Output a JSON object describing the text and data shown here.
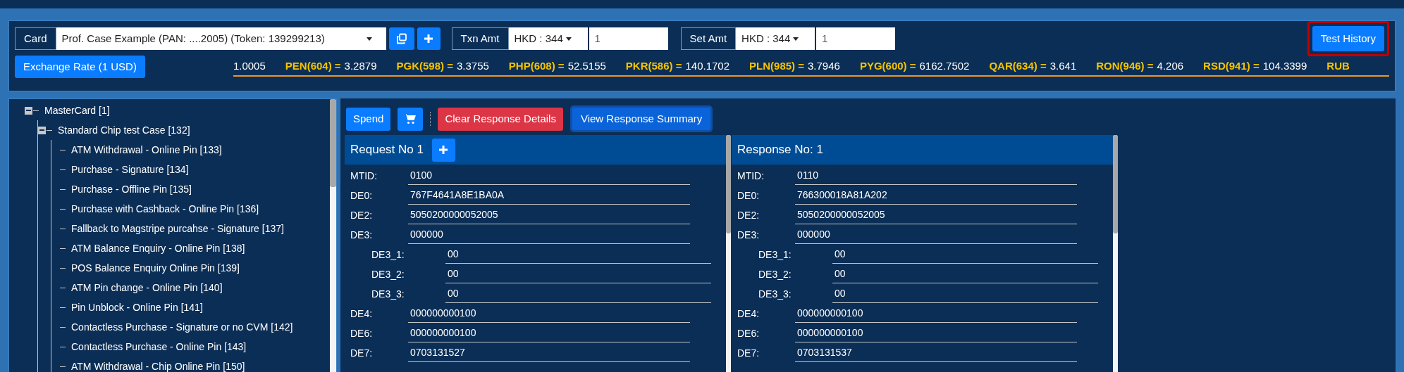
{
  "toolbar": {
    "card": {
      "label": "Card",
      "value": "Prof. Case Example (PAN: ....2005) (Token: 139299213)"
    },
    "txn": {
      "label": "Txn Amt",
      "currency": "HKD : 344",
      "amount": "1"
    },
    "set": {
      "label": "Set Amt",
      "currency": "HKD : 344",
      "amount": "1"
    },
    "test_history": {
      "label": "Test History",
      "highlighted": true
    },
    "exchange_button": "Exchange Rate (1 USD)",
    "rates": [
      {
        "value": "1.0005"
      },
      {
        "code": "PEN(604) =",
        "value": "3.2879"
      },
      {
        "code": "PGK(598) =",
        "value": "3.3755"
      },
      {
        "code": "PHP(608) =",
        "value": "52.5155"
      },
      {
        "code": "PKR(586) =",
        "value": "140.1702"
      },
      {
        "code": "PLN(985) =",
        "value": "3.7946"
      },
      {
        "code": "PYG(600) =",
        "value": "6162.7502"
      },
      {
        "code": "QAR(634) =",
        "value": "3.641"
      },
      {
        "code": "RON(946) =",
        "value": "4.206"
      },
      {
        "code": "RSD(941) =",
        "value": "104.3399"
      },
      {
        "code": "RUB"
      }
    ]
  },
  "tree": [
    {
      "label": "MasterCard [1]",
      "expanded": true,
      "children": [
        {
          "label": "Standard Chip test Case [132]",
          "expanded": true,
          "children": [
            {
              "label": "ATM Withdrawal - Online Pin [133]"
            },
            {
              "label": "Purchase - Signature [134]"
            },
            {
              "label": "Purchase - Offline Pin [135]"
            },
            {
              "label": "Purchase with Cashback - Online Pin [136]"
            },
            {
              "label": "Fallback to Magstripe purcahse - Signature [137]"
            },
            {
              "label": "ATM Balance Enquiry - Online Pin [138]"
            },
            {
              "label": "POS Balance Enquiry Online Pin [139]"
            },
            {
              "label": "ATM Pin change - Online Pin [140]"
            },
            {
              "label": "Pin Unblock - Online Pin [141]"
            },
            {
              "label": "Contactless Purchase - Signature or no CVM [142]"
            },
            {
              "label": "Contactless Purchase - Online Pin [143]"
            },
            {
              "label": "ATM Withdrawal - Chip Online Pin [150]"
            }
          ]
        }
      ]
    }
  ],
  "actions": {
    "spend": "Spend",
    "clear": "Clear Response Details",
    "summary": "View Response Summary"
  },
  "request": {
    "title": "Request No 1",
    "fields": [
      {
        "label": "MTID:",
        "value": "0100"
      },
      {
        "label": "DE0:",
        "value": "767F4641A8E1BA0A"
      },
      {
        "label": "DE2:",
        "value": "5050200000052005"
      },
      {
        "label": "DE3:",
        "value": "000000",
        "children": [
          {
            "label": "DE3_1:",
            "value": "00"
          },
          {
            "label": "DE3_2:",
            "value": "00"
          },
          {
            "label": "DE3_3:",
            "value": "00"
          }
        ]
      },
      {
        "label": "DE4:",
        "value": "000000000100"
      },
      {
        "label": "DE6:",
        "value": "000000000100"
      },
      {
        "label": "DE7:",
        "value": "0703131527"
      }
    ]
  },
  "response": {
    "title": "Response No: 1",
    "fields": [
      {
        "label": "MTID:",
        "value": "0110"
      },
      {
        "label": "DE0:",
        "value": "766300018A81A202"
      },
      {
        "label": "DE2:",
        "value": "5050200000052005"
      },
      {
        "label": "DE3:",
        "value": "000000",
        "children": [
          {
            "label": "DE3_1:",
            "value": "00"
          },
          {
            "label": "DE3_2:",
            "value": "00"
          },
          {
            "label": "DE3_3:",
            "value": "00"
          }
        ]
      },
      {
        "label": "DE4:",
        "value": "000000000100"
      },
      {
        "label": "DE6:",
        "value": "000000000100"
      },
      {
        "label": "DE7:",
        "value": "0703131537"
      }
    ]
  }
}
